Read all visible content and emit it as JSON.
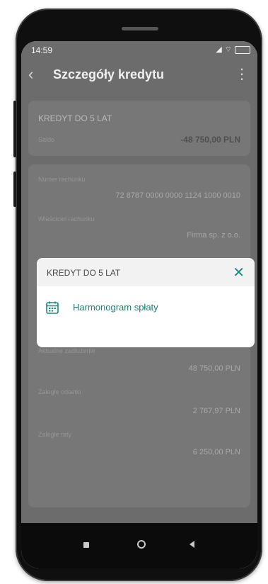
{
  "status_bar": {
    "time": "14:59",
    "icons": [
      "signal-icon",
      "wifi-icon",
      "battery-icon"
    ]
  },
  "app_bar": {
    "title": "Szczegóły kredytu",
    "back_icon": "back-arrow-icon",
    "menu_icon": "more-vertical-icon"
  },
  "summary_card": {
    "heading": "KREDYT DO 5 LAT",
    "balance_label": "Saldo",
    "balance_value": "-48 750,00 PLN"
  },
  "details_card": {
    "account_number_label": "Numer rachunku",
    "account_number_value": "72 8787 0000 0000 1124 1000 0010",
    "owner_label": "Właściciel rachunku",
    "owner_value": "Firma sp. z o.o.",
    "current_debt_label": "Aktualne zadłużenie",
    "current_debt_value": "48 750,00 PLN",
    "overdue_interest_label": "Zaległe odsetki",
    "overdue_interest_value": "2 767,97 PLN",
    "overdue_installment_label": "Zaległe raty",
    "overdue_installment_value": "6 250,00 PLN"
  },
  "modal": {
    "title": "KREDYT DO 5 LAT",
    "close_icon": "close-icon",
    "item": {
      "icon": "calendar-icon",
      "label": "Harmonogram spłaty"
    }
  },
  "colors": {
    "accent": "#1a8a7c",
    "overlay": "#6c6c6c"
  },
  "nav_bar": {
    "buttons": [
      "recent-apps-icon",
      "home-icon",
      "back-icon"
    ]
  }
}
